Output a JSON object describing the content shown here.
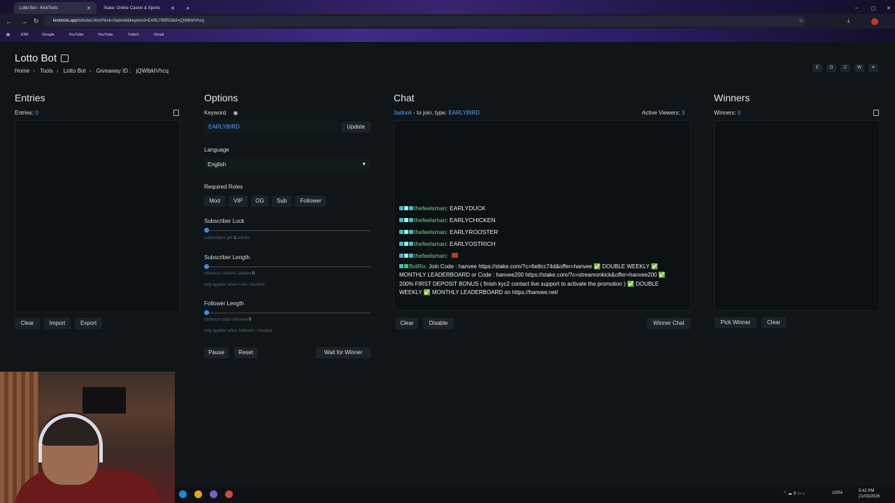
{
  "browser": {
    "tabs": [
      {
        "label": "Lotto Bot - KickTools",
        "active": true
      },
      {
        "label": "Stake: Online Casino & Sports",
        "active": false
      }
    ],
    "url_host": "kicktools.app",
    "url_path": "/lottobot.html?kick=3adooli&keyword=EARLYBIRD&id=jQWlbkIVhcq",
    "bookmarks": [
      "ENF",
      "Google",
      "YouTube",
      "YouTube",
      "Twitch",
      "Gmail"
    ]
  },
  "app": {
    "title": "Lotto Bot",
    "breadcrumb": [
      "Home",
      "Tools",
      "Lotto Bot"
    ],
    "giveaway_label": "Giveaway ID :",
    "giveaway_id": "jQWlbkIVhcq",
    "top_buttons": [
      "E",
      "O",
      "C",
      "W",
      "☀"
    ]
  },
  "entries": {
    "heading": "Entries",
    "count_label": "Entries:",
    "count": "0",
    "buttons": [
      "Clear",
      "Import",
      "Export"
    ]
  },
  "options": {
    "heading": "Options",
    "keyword_label": "Keyword",
    "keyword_value": "EARLYBIRD",
    "update_label": "Update",
    "language_label": "Language",
    "language_value": "English",
    "roles_label": "Required Roles",
    "roles": [
      "Mod",
      "VIP",
      "OG",
      "Sub",
      "Follower"
    ],
    "sub_luck_label": "Subscriber Luck",
    "sub_luck_hint_a": "subscribers get",
    "sub_luck_hint_b": "entries",
    "sub_luck_value": "1",
    "sub_length_label": "Subscriber Length",
    "sub_length_hint": "minimum months subbed",
    "sub_length_value": "0",
    "sub_length_hint2": "only applies when subs checked",
    "follower_label": "Follower Length",
    "follower_hint": "minimum days followed",
    "follower_value": "0",
    "follower_hint2": "only applies when followers checked",
    "pause_label": "Pause",
    "reset_label": "Reset",
    "wait_label": "Wait for Winner"
  },
  "chat": {
    "heading": "Chat",
    "channel": "3adooli",
    "join_text": "- to join, type:",
    "keyword": "EARLYBIRD",
    "viewers_label": "Active Viewers:",
    "viewers": "3",
    "messages": [
      {
        "user": "thefeelsman:",
        "text": "EARLYDUCK"
      },
      {
        "user": "thefeelsman:",
        "text": "EARLYCHICKEN"
      },
      {
        "user": "thefeelsman:",
        "text": "EARLYROOSTER"
      },
      {
        "user": "thefeelsman:",
        "text": "EARLYOSTRICH"
      },
      {
        "user": "thefeelsman:",
        "text": ""
      }
    ],
    "bot_user": "BotRix:",
    "bot_text": "Join Code : hanvee https://stake.com/?c=6e8cc74d&offer=hanvee ✅ DOUBLE WEEKLY ✅ MONTHLY LEADERBOARD or Code : hanvee200 https://stake.com/?c=streamonkick&offer=hanvee200 ✅ 200% FIRST DEPOSIT BONUS ( finish kyc2 contact live support to activate the promotion ) ✅ DOUBLE WEEKLY ✅ MONTHLY LEADERBOARD on https://hanvee.net/",
    "clear_label": "Clear",
    "disable_label": "Disable",
    "winner_chat_label": "Winner Chat"
  },
  "winners": {
    "heading": "Winners",
    "count_label": "Winners:",
    "count": "0",
    "pick_label": "Pick Winner",
    "clear_label": "Clear"
  },
  "taskbar": {
    "battery": "100%",
    "time": "5:42 PM",
    "date": "21/03/2026"
  },
  "colors": {
    "accent": "#5ea0ff",
    "background": "#0f1519",
    "username": "#7fcf8f"
  }
}
